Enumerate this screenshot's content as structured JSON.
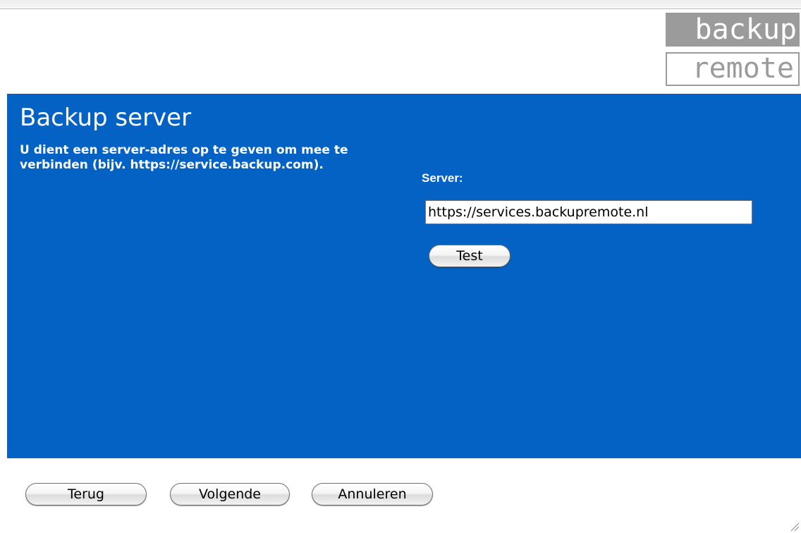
{
  "logo": {
    "top_text": "backup",
    "bottom_text": "remote"
  },
  "page": {
    "title": "Backup server",
    "description": "U dient een server-adres op te geven om mee te verbinden (bijv. https://service.backup.com)."
  },
  "server": {
    "label": "Server:",
    "value": "https://services.backupremote.nl",
    "test_label": "Test"
  },
  "footer": {
    "back_label": "Terug",
    "next_label": "Volgende",
    "cancel_label": "Annuleren"
  },
  "colors": {
    "panel": "#0562c5",
    "logo_gray": "#9b9b9b",
    "text_on_panel": "#ffffff"
  }
}
